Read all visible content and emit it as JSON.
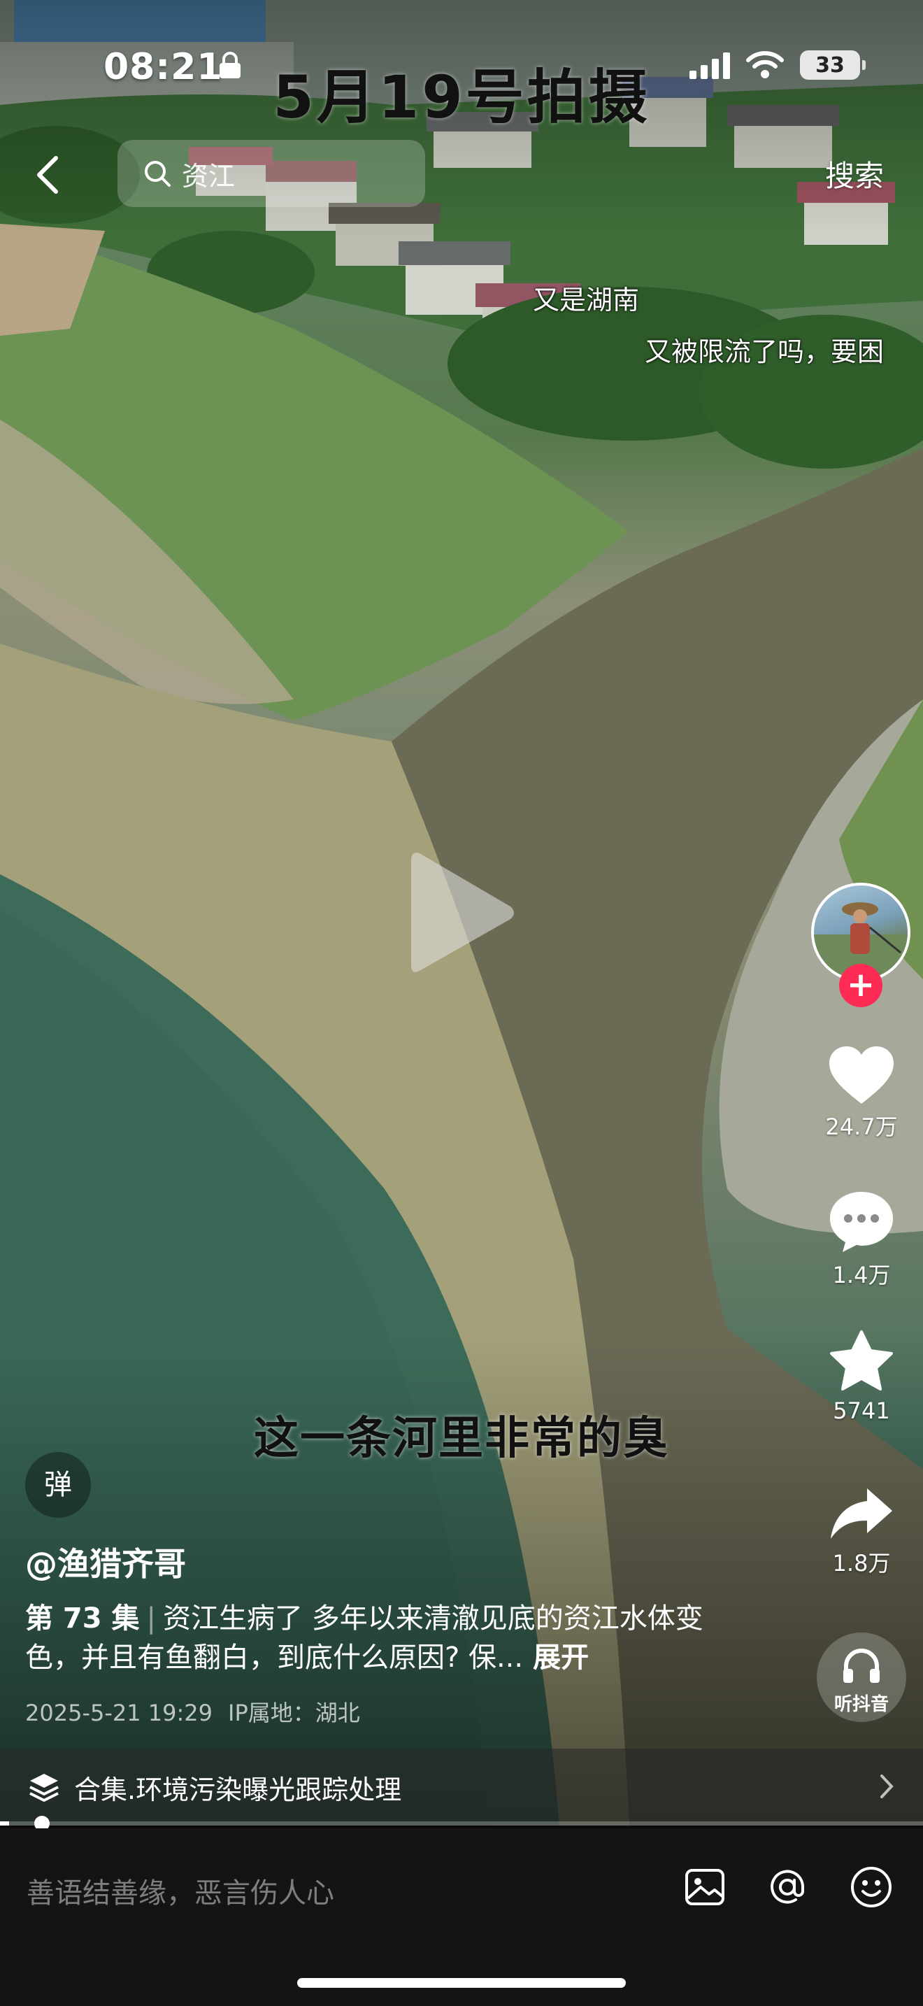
{
  "status_bar": {
    "time": "08:21",
    "battery": "33"
  },
  "video": {
    "date_overlay": "5月19号拍摄",
    "subtitle": "这一条河里非常的臭"
  },
  "top_nav": {
    "search_text": "资江",
    "search_button": "搜索"
  },
  "danmaku": [
    "又是湖南",
    "又被限流了吗，要困"
  ],
  "side_actions": {
    "likes": "24.7万",
    "comments": "1.4万",
    "favorites": "5741",
    "shares": "1.8万",
    "listen_label": "听抖音"
  },
  "post": {
    "danmu_toggle": "弹",
    "author": "@渔猎齐哥",
    "episode": "第 73 集",
    "caption": "资江生病了 多年以来清澈见底的资江水体变色，并且有鱼翻白，到底什么原因? 保...",
    "expand": "展开",
    "date": "2025-5-21 19:29",
    "ip_location": "IP属地：湖北"
  },
  "collection": {
    "label": "合集.环境污染曝光跟踪处理"
  },
  "playback": {
    "progress_fraction": 0.01
  },
  "comment_bar": {
    "placeholder": "善语结善缘，恶言伤人心"
  },
  "icons": [
    "back-icon",
    "search-icon",
    "play-icon",
    "heart-icon",
    "comment-icon",
    "star-icon",
    "share-icon",
    "headphones-icon",
    "layers-icon",
    "chevron-right-icon",
    "image-icon",
    "at-icon",
    "emoji-icon",
    "signal-icon",
    "wifi-icon",
    "lock-icon"
  ],
  "colors": {
    "follow_accent": "#fe2c55",
    "bottom_bar": "#141414"
  }
}
